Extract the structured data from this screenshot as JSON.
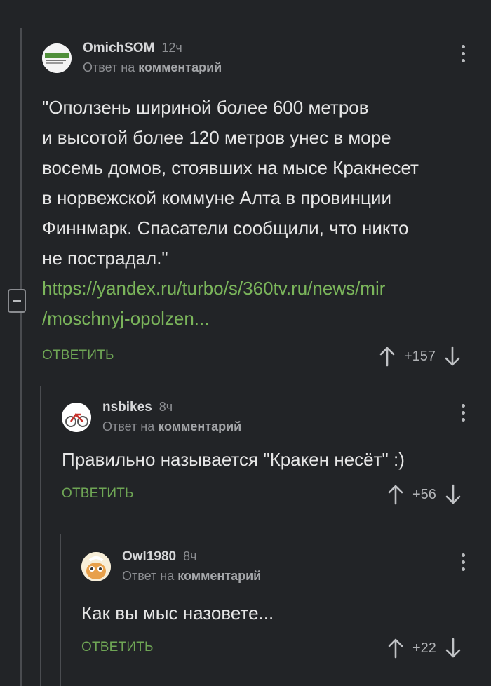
{
  "comments": [
    {
      "username": "OmichSOM",
      "time": "12ч",
      "reply_prefix": "Ответ на",
      "reply_target": "комментарий",
      "body_lines": [
        "\"Оползень шириной более 600 метров",
        "и высотой более 120 метров унес в море",
        "восемь домов, стоявших на мысе Кракнесет",
        "в норвежской коммуне Алта в провинции",
        "Финнмарк. Спасатели сообщили, что никто",
        "не пострадал.\""
      ],
      "link_lines": [
        "https://yandex.ru/turbo/s/360tv.ru/news/mir",
        "/moschnyj-opolzen..."
      ],
      "reply_label": "ОТВЕТИТЬ",
      "score": "+157"
    },
    {
      "username": "nsbikes",
      "time": "8ч",
      "reply_prefix": "Ответ на",
      "reply_target": "комментарий",
      "body": "Правильно называется \"Кракен несёт\" :)",
      "reply_label": "ОТВЕТИТЬ",
      "score": "+56"
    },
    {
      "username": "Owl1980",
      "time": "8ч",
      "reply_prefix": "Ответ на",
      "reply_target": "комментарий",
      "body": "Как вы мыс назовете...",
      "reply_label": "ОТВЕТИТЬ",
      "score": "+22"
    }
  ],
  "colors": {
    "background": "#222427",
    "link": "#7bb55b",
    "reply": "#6fa655",
    "thread_line": "#4a4c50"
  },
  "icons": [
    "more-vertical-icon",
    "arrow-up-icon",
    "arrow-down-icon",
    "collapse-icon"
  ]
}
